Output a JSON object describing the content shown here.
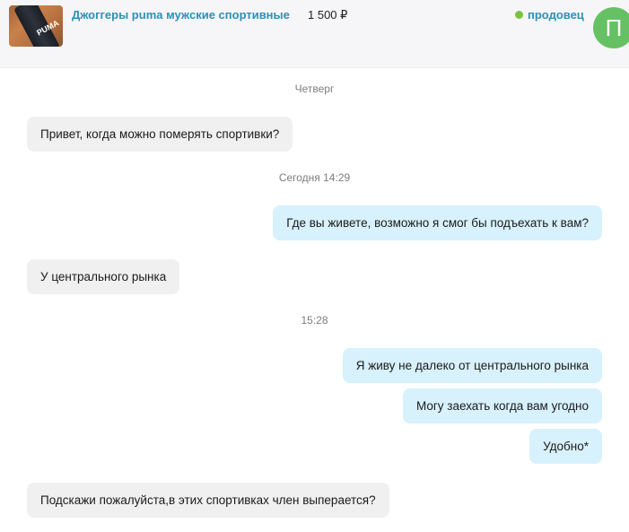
{
  "header": {
    "product_title": "Джоггеры puma мужские спортивные",
    "price": "1 500 ₽",
    "seller_label": "продовец",
    "avatar_letter": "П",
    "thumbnail_logo": "PUMA"
  },
  "colors": {
    "link_blue": "#2d8fb5",
    "online_green": "#7cc241",
    "avatar_green": "#66c064",
    "incoming_bubble": "#f0f0f0",
    "outgoing_bubble": "#d7f1fd"
  },
  "chat": {
    "date_thursday": "Четверг",
    "date_today": "Сегодня 14:29",
    "time_1528": "15:28",
    "messages": [
      {
        "direction": "incoming",
        "text": "Привет, когда можно померять спортивки?"
      },
      {
        "direction": "outgoing",
        "text": "Где вы живете, возможно я смог бы подъехать к вам?"
      },
      {
        "direction": "incoming",
        "text": "У центрального рынка"
      },
      {
        "direction": "outgoing",
        "text": "Я живу не далеко от центрального рынка"
      },
      {
        "direction": "outgoing",
        "text": "Могу заехать когда вам угодно"
      },
      {
        "direction": "outgoing",
        "text": "Удобно*"
      },
      {
        "direction": "incoming",
        "text": "Подскажи пожалуйста,в этих спортивках член выперается?"
      }
    ]
  }
}
